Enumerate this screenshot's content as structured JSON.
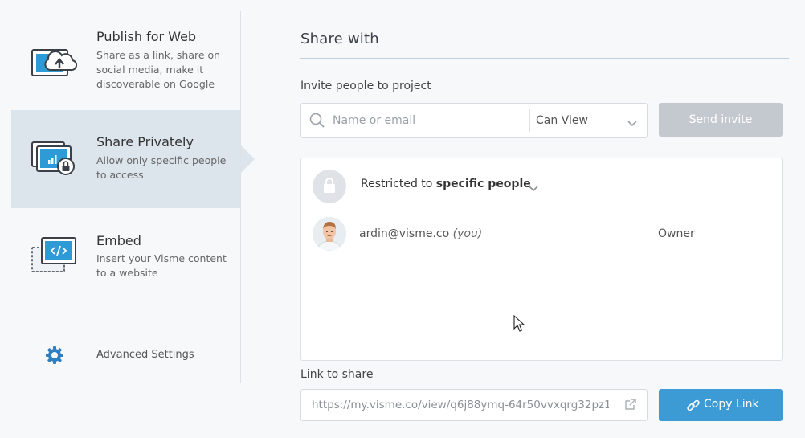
{
  "sidebar": {
    "items": [
      {
        "title": "Publish for Web",
        "desc": "Share as a link, share on social media, make it discoverable on Google",
        "icon": "cloud-upload-icon"
      },
      {
        "title": "Share Privately",
        "desc": "Allow only specific people to access",
        "icon": "private-share-icon"
      },
      {
        "title": "Embed",
        "desc": "Insert your Visme content to a website",
        "icon": "embed-code-icon"
      }
    ],
    "advanced_label": "Advanced Settings"
  },
  "main": {
    "title": "Share with",
    "invite_label": "Invite people to project",
    "invite_placeholder": "Name or email",
    "permission": "Can View",
    "send_label": "Send invite",
    "restricted_prefix": "Restricted to",
    "restricted_bold": "specific people",
    "people": [
      {
        "email": "ardin@visme.co",
        "suffix": "(you)",
        "role": "Owner"
      }
    ],
    "link_label": "Link to share",
    "link_url": "https://my.visme.co/view/q6j88ymq-64r50vvxqrg32pz1",
    "copy_label": "Copy Link"
  },
  "colors": {
    "accent": "#3c9ad4",
    "active_bg": "#dce4ec",
    "disabled_btn": "#c4c9d0"
  }
}
